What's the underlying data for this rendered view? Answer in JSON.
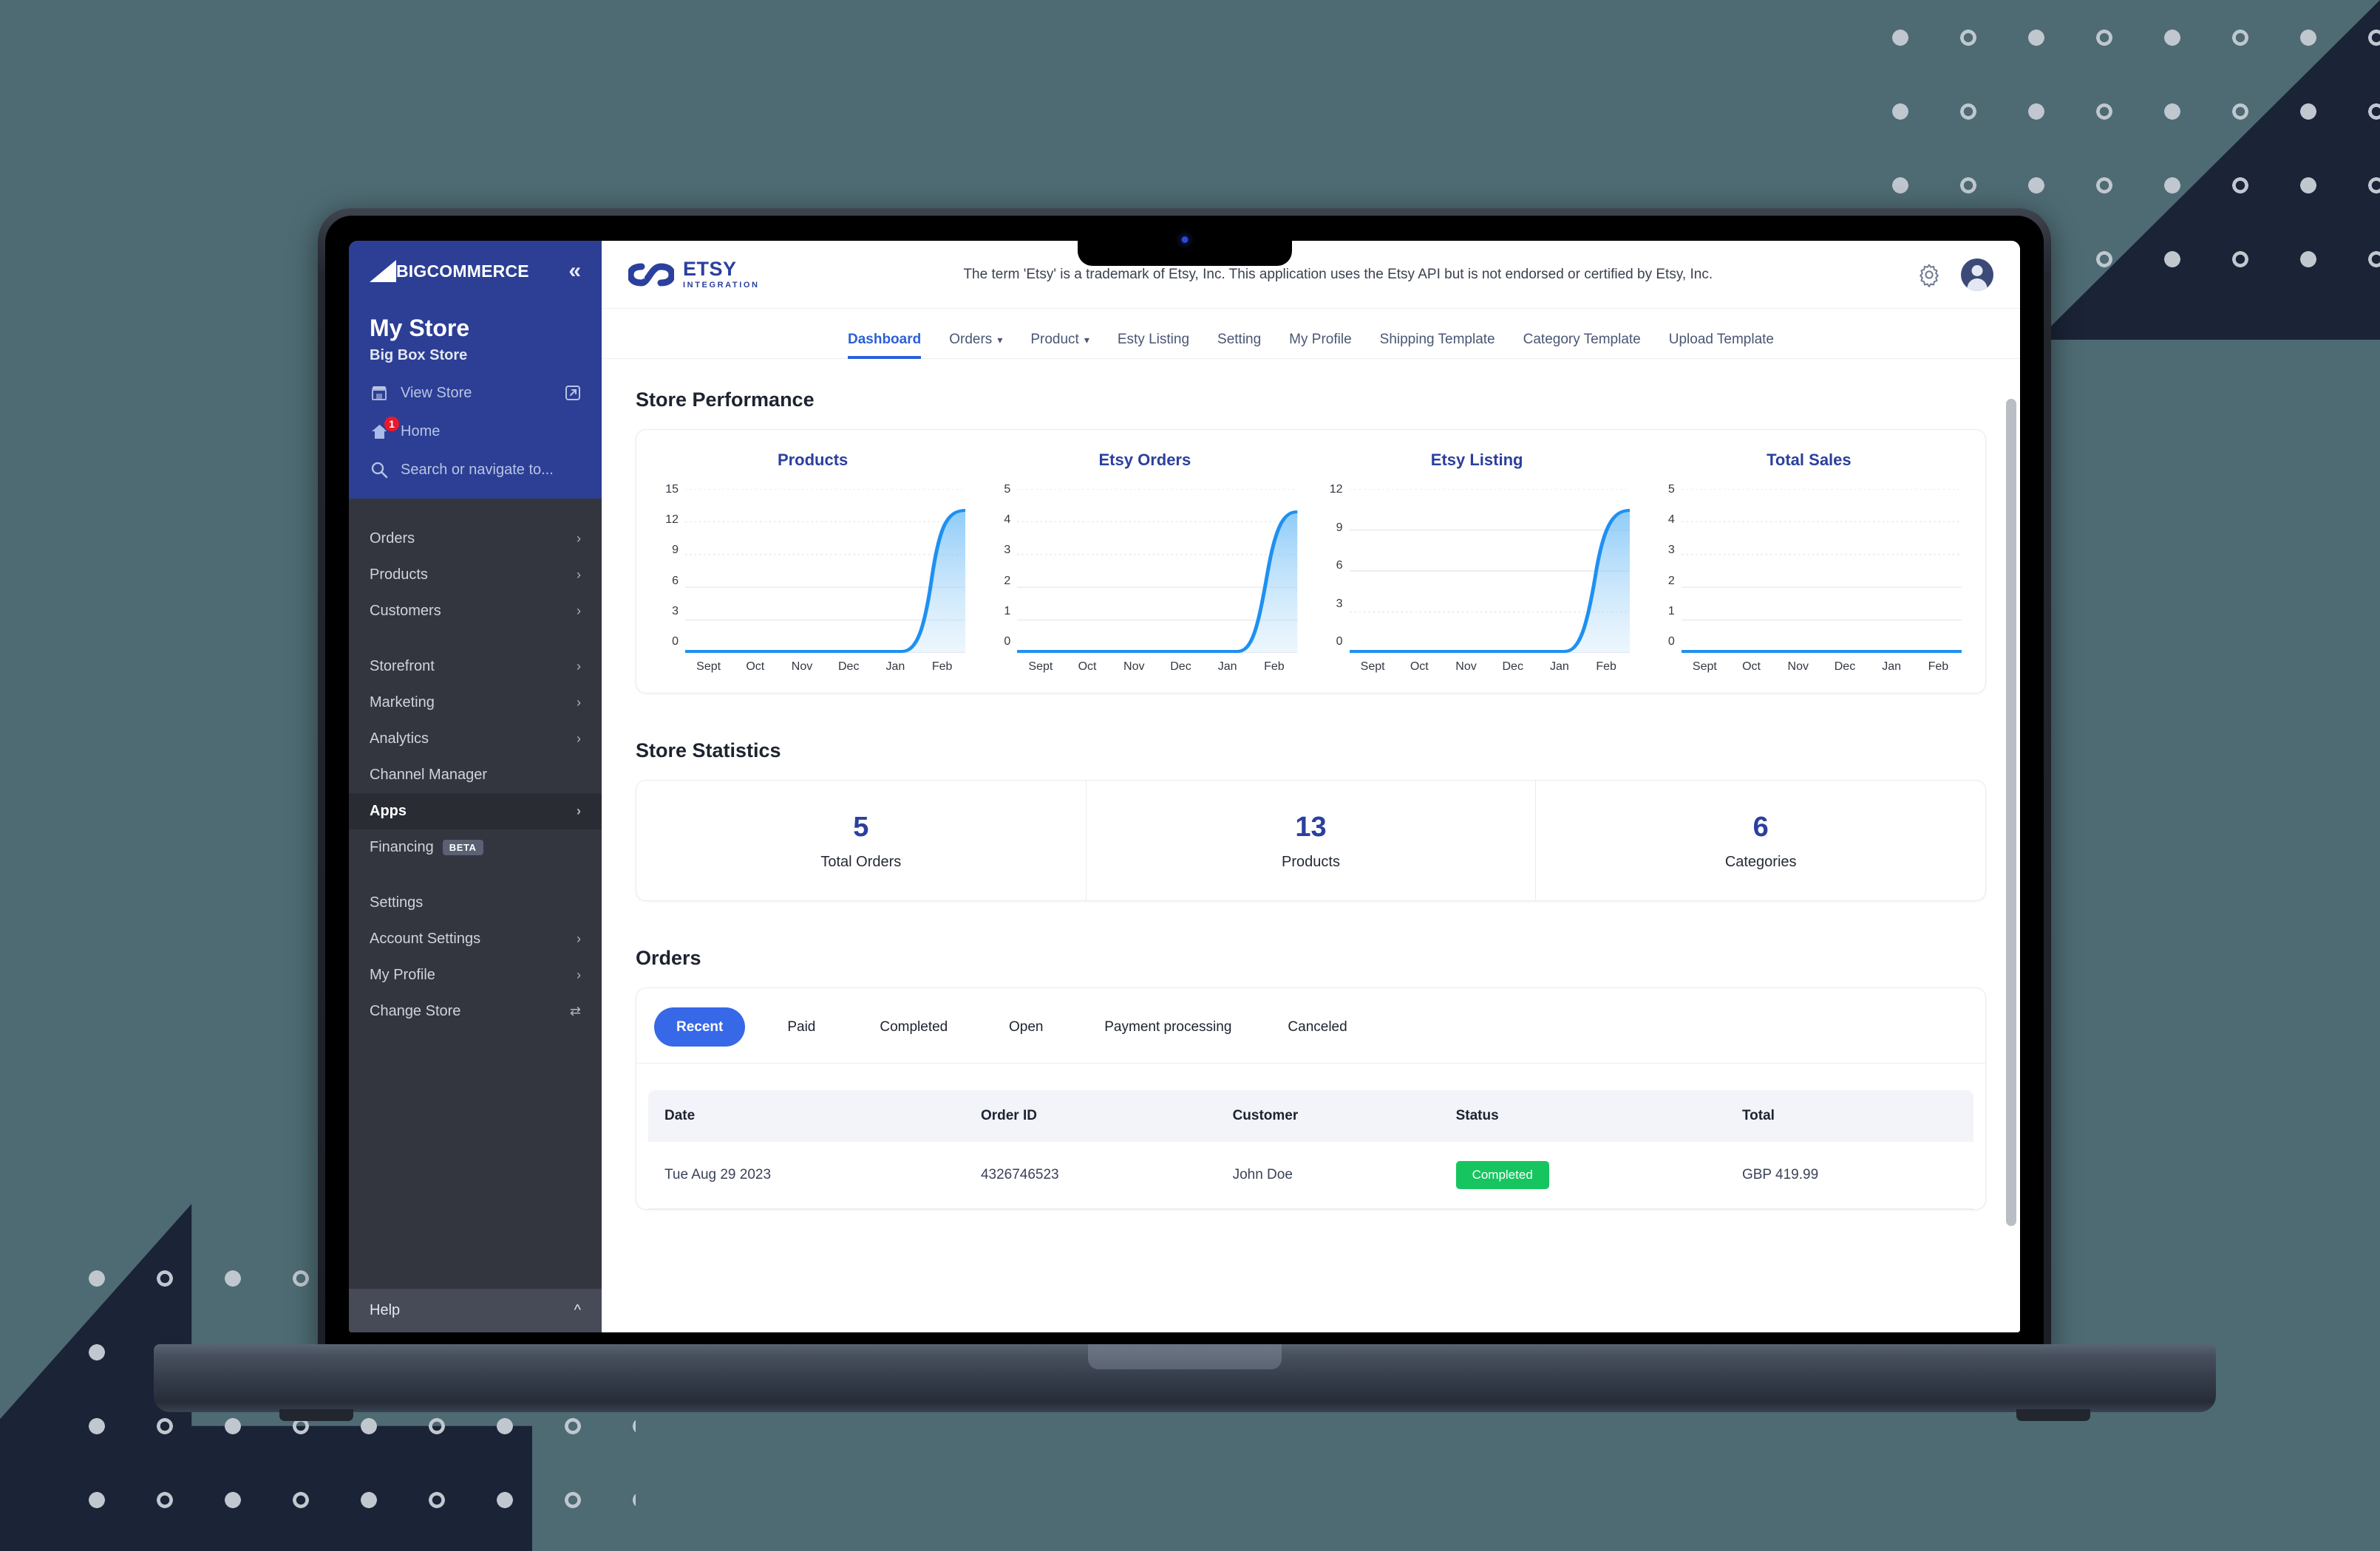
{
  "bigcommerce_sidebar": {
    "brand": "COMMERCE",
    "brand_prefix": "BIG",
    "collapse_icon": "chevron-double-left-icon",
    "store_name": "My Store",
    "store_subtitle": "Big Box Store",
    "quick_links": [
      {
        "label": "View Store",
        "icon": "storefront-icon",
        "trailing_icon": "external-link-icon"
      },
      {
        "label": "Home",
        "icon": "home-icon",
        "badge": "1"
      },
      {
        "label": "Search or navigate to...",
        "icon": "search-icon"
      }
    ],
    "groups": [
      {
        "items": [
          {
            "label": "Orders",
            "has_chevron": true
          },
          {
            "label": "Products",
            "has_chevron": true
          },
          {
            "label": "Customers",
            "has_chevron": true
          }
        ]
      },
      {
        "items": [
          {
            "label": "Storefront",
            "has_chevron": true
          },
          {
            "label": "Marketing",
            "has_chevron": true
          },
          {
            "label": "Analytics",
            "has_chevron": true
          },
          {
            "label": "Channel Manager",
            "has_chevron": false
          },
          {
            "label": "Apps",
            "has_chevron": true,
            "active": true
          },
          {
            "label": "Financing",
            "has_chevron": false,
            "tag": "BETA"
          }
        ]
      },
      {
        "items": [
          {
            "label": "Settings",
            "has_chevron": false
          },
          {
            "label": "Account Settings",
            "has_chevron": true
          },
          {
            "label": "My Profile",
            "has_chevron": true
          },
          {
            "label": "Change Store",
            "has_chevron": false,
            "trailing_icon": "swap-icon"
          }
        ]
      }
    ],
    "help_label": "Help",
    "help_icon": "chevron-up-icon"
  },
  "app_header": {
    "logo_main": "ETSY",
    "logo_sub": "INTEGRATION",
    "logo_icon": "etsy-sync-infinity-icon",
    "disclaimer": "The term 'Etsy' is a trademark of Etsy, Inc. This application uses the Etsy API but is not endorsed or certified by Etsy, Inc.",
    "settings_icon": "gear-icon",
    "avatar_icon": "user-avatar-icon"
  },
  "app_nav": {
    "tabs": [
      {
        "label": "Dashboard",
        "active": true,
        "dropdown": false
      },
      {
        "label": "Orders",
        "active": false,
        "dropdown": true
      },
      {
        "label": "Product",
        "active": false,
        "dropdown": true
      },
      {
        "label": "Esty Listing",
        "active": false,
        "dropdown": false
      },
      {
        "label": "Setting",
        "active": false,
        "dropdown": false
      },
      {
        "label": "My Profile",
        "active": false,
        "dropdown": false
      },
      {
        "label": "Shipping Template",
        "active": false,
        "dropdown": false
      },
      {
        "label": "Category Template",
        "active": false,
        "dropdown": false
      },
      {
        "label": "Upload Template",
        "active": false,
        "dropdown": false
      }
    ]
  },
  "store_performance": {
    "title": "Store Performance"
  },
  "store_statistics": {
    "title": "Store Statistics",
    "cells": [
      {
        "value": "5",
        "label": "Total Orders"
      },
      {
        "value": "13",
        "label": "Products"
      },
      {
        "value": "6",
        "label": "Categories"
      }
    ]
  },
  "orders": {
    "title": "Orders",
    "tabs": [
      {
        "label": "Recent",
        "active": true
      },
      {
        "label": "Paid",
        "active": false
      },
      {
        "label": "Completed",
        "active": false
      },
      {
        "label": "Open",
        "active": false
      },
      {
        "label": "Payment processing",
        "active": false
      },
      {
        "label": "Canceled",
        "active": false
      }
    ],
    "columns": [
      "Date",
      "Order ID",
      "Customer",
      "Status",
      "Total"
    ],
    "rows": [
      {
        "date": "Tue Aug 29 2023",
        "order_id": "4326746523",
        "customer": "John Doe",
        "status": "Completed",
        "total": "GBP 419.99"
      }
    ],
    "status_color": "#16c55f"
  },
  "colors": {
    "background": "#4e6b73",
    "wedge": "#1b2337",
    "sidebar_top": "#2c3f95",
    "sidebar_body": "#34363f",
    "accent_blue": "#2b5fd9",
    "chart_line": "#1e90f2",
    "chart_title": "#2b3f9e",
    "status_green": "#16c55f"
  },
  "chart_data": [
    {
      "type": "area",
      "title": "Products",
      "x": [
        "Sept",
        "Oct",
        "Nov",
        "Dec",
        "Jan",
        "Feb"
      ],
      "values": [
        0,
        0,
        0,
        0,
        0.1,
        13
      ],
      "ylim": [
        0,
        15
      ],
      "yticks": [
        0,
        3,
        6,
        9,
        12,
        15
      ],
      "xlabel": "",
      "ylabel": "",
      "grid": true,
      "legend": "none"
    },
    {
      "type": "area",
      "title": "Etsy Orders",
      "x": [
        "Sept",
        "Oct",
        "Nov",
        "Dec",
        "Jan",
        "Feb"
      ],
      "values": [
        0,
        0,
        0,
        0,
        0.05,
        4.3
      ],
      "ylim": [
        0,
        5
      ],
      "yticks": [
        0,
        1,
        2,
        3,
        4,
        5
      ],
      "xlabel": "",
      "ylabel": "",
      "grid": true,
      "legend": "none"
    },
    {
      "type": "area",
      "title": "Etsy Listing",
      "x": [
        "Sept",
        "Oct",
        "Nov",
        "Dec",
        "Jan",
        "Feb"
      ],
      "values": [
        0,
        0,
        0,
        0,
        0.05,
        11
      ],
      "ylim": [
        0,
        12
      ],
      "yticks": [
        0,
        3,
        6,
        9,
        12
      ],
      "xlabel": "",
      "ylabel": "",
      "grid": true,
      "legend": "none"
    },
    {
      "type": "area",
      "title": "Total Sales",
      "x": [
        "Sept",
        "Oct",
        "Nov",
        "Dec",
        "Jan",
        "Feb"
      ],
      "values": [
        0,
        0,
        0,
        0,
        0,
        0
      ],
      "ylim": [
        0,
        5
      ],
      "yticks": [
        0,
        1,
        2,
        3,
        4,
        5
      ],
      "xlabel": "",
      "ylabel": "",
      "grid": true,
      "legend": "none"
    }
  ]
}
